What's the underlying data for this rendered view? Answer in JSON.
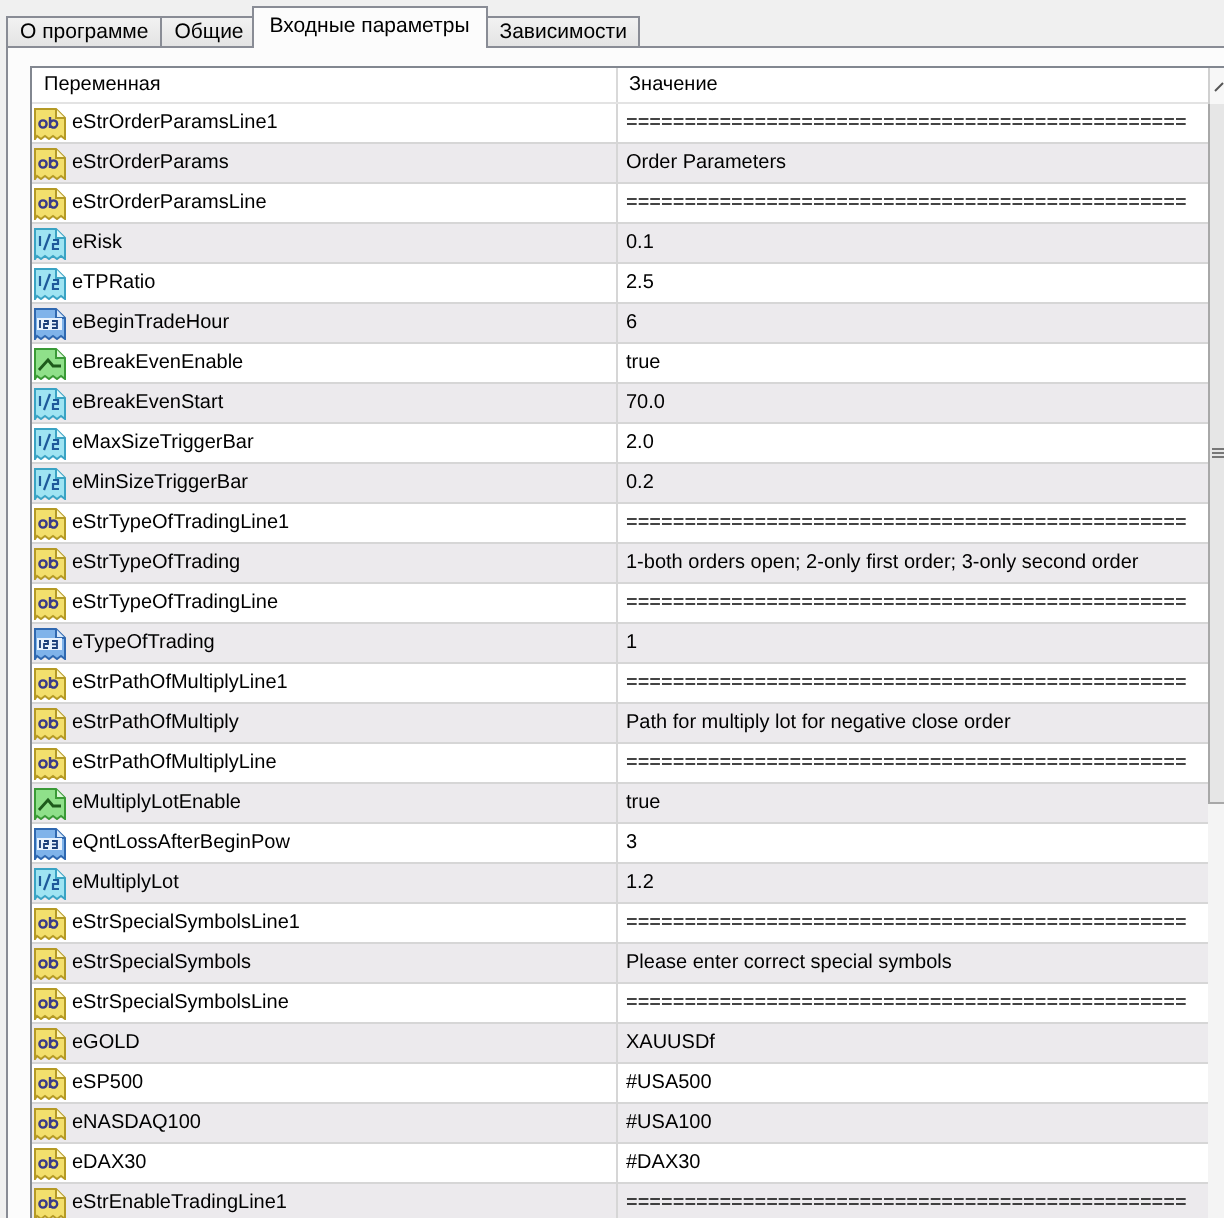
{
  "tabs": [
    {
      "label": "О программе",
      "selected": false
    },
    {
      "label": "Общие",
      "selected": false
    },
    {
      "label": "Входные параметры",
      "selected": true
    },
    {
      "label": "Зависимости",
      "selected": false
    }
  ],
  "table": {
    "columns": [
      "Переменная",
      "Значение"
    ],
    "rows": [
      {
        "kind": "string",
        "name": "eStrOrderParamsLine1",
        "value": "================================================"
      },
      {
        "kind": "string",
        "name": "eStrOrderParams",
        "value": "Order Parameters"
      },
      {
        "kind": "string",
        "name": "eStrOrderParamsLine",
        "value": "================================================"
      },
      {
        "kind": "double",
        "name": "eRisk",
        "value": "0.1"
      },
      {
        "kind": "double",
        "name": "eTPRatio",
        "value": "2.5"
      },
      {
        "kind": "int",
        "name": "eBeginTradeHour",
        "value": "6"
      },
      {
        "kind": "bool",
        "name": "eBreakEvenEnable",
        "value": "true"
      },
      {
        "kind": "double",
        "name": "eBreakEvenStart",
        "value": "70.0"
      },
      {
        "kind": "double",
        "name": "eMaxSizeTriggerBar",
        "value": "2.0"
      },
      {
        "kind": "double",
        "name": "eMinSizeTriggerBar",
        "value": "0.2"
      },
      {
        "kind": "string",
        "name": "eStrTypeOfTradingLine1",
        "value": "================================================"
      },
      {
        "kind": "string",
        "name": "eStrTypeOfTrading",
        "value": "1-both orders open; 2-only first order; 3-only second order"
      },
      {
        "kind": "string",
        "name": "eStrTypeOfTradingLine",
        "value": "================================================"
      },
      {
        "kind": "int",
        "name": "eTypeOfTrading",
        "value": "1"
      },
      {
        "kind": "string",
        "name": "eStrPathOfMultiplyLine1",
        "value": "================================================"
      },
      {
        "kind": "string",
        "name": "eStrPathOfMultiply",
        "value": "Path for multiply lot for negative close order"
      },
      {
        "kind": "string",
        "name": "eStrPathOfMultiplyLine",
        "value": "================================================"
      },
      {
        "kind": "bool",
        "name": "eMultiplyLotEnable",
        "value": "true"
      },
      {
        "kind": "int",
        "name": "eQntLossAfterBeginPow",
        "value": "3"
      },
      {
        "kind": "double",
        "name": "eMultiplyLot",
        "value": "1.2"
      },
      {
        "kind": "string",
        "name": "eStrSpecialSymbolsLine1",
        "value": "================================================"
      },
      {
        "kind": "string",
        "name": "eStrSpecialSymbols",
        "value": "Please enter correct special symbols"
      },
      {
        "kind": "string",
        "name": "eStrSpecialSymbolsLine",
        "value": "================================================"
      },
      {
        "kind": "string",
        "name": "eGOLD",
        "value": "XAUUSDf"
      },
      {
        "kind": "string",
        "name": "eSP500",
        "value": "#USA500"
      },
      {
        "kind": "string",
        "name": "eNASDAQ100",
        "value": "#USA100"
      },
      {
        "kind": "string",
        "name": "eDAX30",
        "value": "#DAX30"
      },
      {
        "kind": "string",
        "name": "eStrEnableTradingLine1",
        "value": "================================================"
      }
    ]
  }
}
